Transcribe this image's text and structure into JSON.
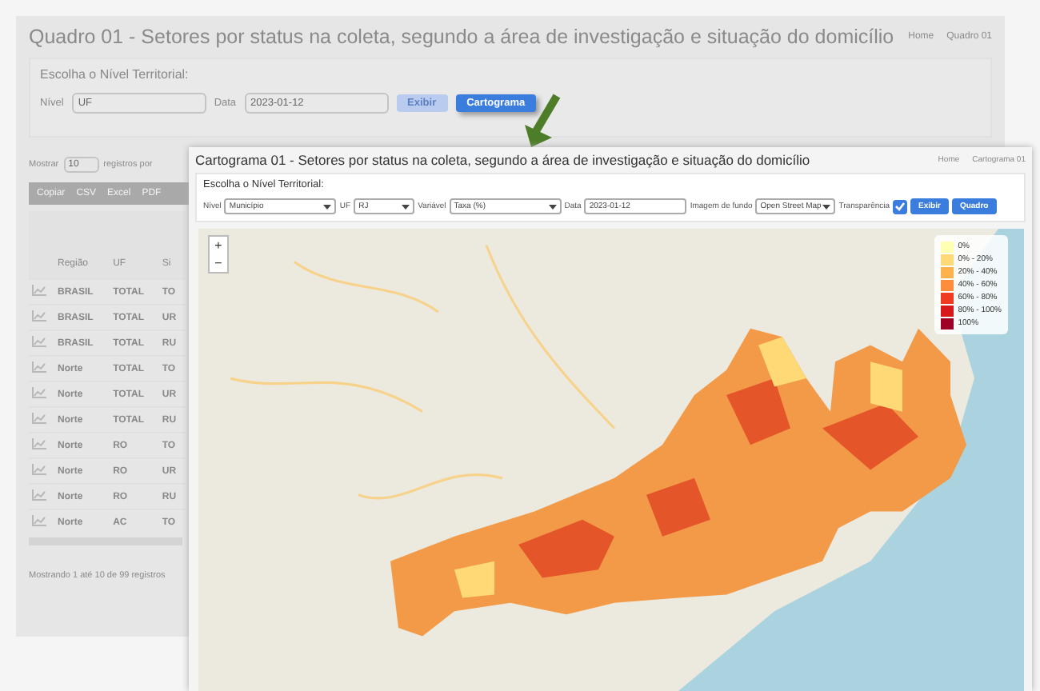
{
  "background_page": {
    "title": "Quadro 01 - Setores por status na coleta, segundo a área de investigação e situação do domicílio",
    "breadcrumb": [
      "Home",
      "Quadro 01"
    ],
    "filter_heading": "Escolha o Nível Territorial:",
    "level": {
      "label": "Nível",
      "value": "UF"
    },
    "date": {
      "label": "Data",
      "value": "2023-01-12"
    },
    "buttons": [
      {
        "label": "Exibir",
        "kind": "plain"
      },
      {
        "label": "Cartograma",
        "kind": "primary"
      }
    ],
    "show": {
      "label": "Mostrar",
      "value": "10",
      "suffix": "registros por"
    },
    "export_buttons": [
      "Copiar",
      "CSV",
      "Excel",
      "PDF"
    ],
    "table": {
      "columns": [
        "Região",
        "UF",
        "Si"
      ],
      "rows": [
        [
          "BRASIL",
          "TOTAL",
          "TO"
        ],
        [
          "BRASIL",
          "TOTAL",
          "UR"
        ],
        [
          "BRASIL",
          "TOTAL",
          "RU"
        ],
        [
          "Norte",
          "TOTAL",
          "TO"
        ],
        [
          "Norte",
          "TOTAL",
          "UR"
        ],
        [
          "Norte",
          "TOTAL",
          "RU"
        ],
        [
          "Norte",
          "RO",
          "TO"
        ],
        [
          "Norte",
          "RO",
          "UR"
        ],
        [
          "Norte",
          "RO",
          "RU"
        ],
        [
          "Norte",
          "AC",
          "TO"
        ]
      ]
    },
    "footer": "Mostrando 1 até 10 de 99 registros"
  },
  "cartogram_window": {
    "title": "Cartograma 01 - Setores por status na coleta, segundo a área de investigação e situação do domicílio",
    "breadcrumb": [
      "Home",
      "Cartograma 01"
    ],
    "filter_heading": "Escolha o Nível Territorial:",
    "selects": [
      {
        "label": "Nível",
        "value": "Município"
      },
      {
        "label": "UF",
        "value": "RJ"
      },
      {
        "label": "Variável",
        "value": "Taxa (%)"
      }
    ],
    "date": {
      "label": "Data",
      "value": "2023-01-12"
    },
    "basemap": {
      "label": "Imagem de fundo",
      "value": "Open Street Map"
    },
    "transparency": {
      "label": "Transparência",
      "checked": true
    },
    "buttons": [
      "Exibir",
      "Quadro"
    ],
    "zoom_controls": [
      "+",
      "−"
    ],
    "legend": [
      {
        "label": "0%",
        "color": "#ffffb2"
      },
      {
        "label": "0% - 20%",
        "color": "#fed976"
      },
      {
        "label": "20% - 40%",
        "color": "#feb24c"
      },
      {
        "label": "40% - 60%",
        "color": "#fd8d3c"
      },
      {
        "label": "60% - 80%",
        "color": "#f03b20"
      },
      {
        "label": "80% - 100%",
        "color": "#d7191c"
      },
      {
        "label": "100%",
        "color": "#9e0026"
      }
    ]
  }
}
